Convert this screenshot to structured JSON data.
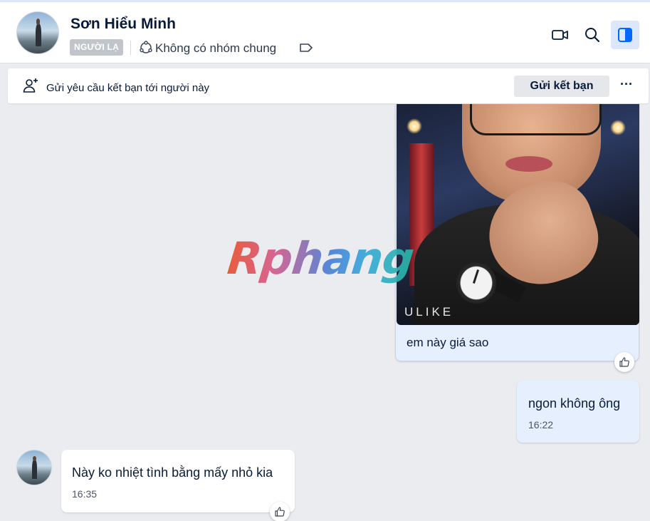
{
  "header": {
    "contact_name": "Sơn Hiểu Minh",
    "stranger_badge": "NGƯỜI LẠ",
    "common_groups": "Không có nhóm chung"
  },
  "friend_request": {
    "text": "Gửi yêu cầu kết bạn tới người này",
    "button_label": "Gửi kết bạn",
    "more_label": "···"
  },
  "messages": [
    {
      "sender": "me",
      "type": "image",
      "image_watermark_text": "ULIKE",
      "caption": "em này giá sao"
    },
    {
      "sender": "me",
      "type": "text",
      "text": "ngon không ông",
      "time": "16:22"
    },
    {
      "sender": "them",
      "type": "text",
      "text": "Này ko nhiệt tình bằng mấy nhỏ kia",
      "time": "16:35"
    }
  ],
  "watermark": "Rphang",
  "colors": {
    "my_bubble": "#e5effd",
    "their_bubble": "#ffffff",
    "chat_background": "#ebecf0",
    "panel_toggle_active": "#dbe8fb",
    "accent": "#0068ff"
  },
  "icons": [
    "video-call-icon",
    "search-icon",
    "panel-toggle-icon",
    "group-icon",
    "tag-icon",
    "add-friend-icon",
    "thumbs-up-icon"
  ]
}
